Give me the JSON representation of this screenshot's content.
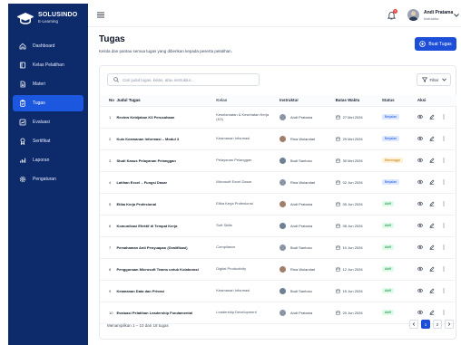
{
  "brand": {
    "name": "SOLUSINDO",
    "subtitle": "E-Learning"
  },
  "sidebar": {
    "items": [
      {
        "label": "Dashboard",
        "icon": "home-icon",
        "active": false
      },
      {
        "label": "Kelas Pelatihan",
        "icon": "book-icon",
        "active": false
      },
      {
        "label": "Materi",
        "icon": "document-icon",
        "active": false
      },
      {
        "label": "Tugas",
        "icon": "clipboard-icon",
        "active": true
      },
      {
        "label": "Evaluasi",
        "icon": "chart-line-icon",
        "active": false
      },
      {
        "label": "Sertifikat",
        "icon": "award-icon",
        "active": false
      },
      {
        "label": "Laporan",
        "icon": "bar-chart-icon",
        "active": false
      },
      {
        "label": "Pengaturan",
        "icon": "gear-icon",
        "active": false
      }
    ]
  },
  "topbar": {
    "notification_count": "3",
    "user_name": "Andi Pratama",
    "user_role": "Instruktur"
  },
  "page": {
    "title": "Tugas",
    "subtitle": "Kelola dan pantau semua tugas yang diberikan kepada peserta pelatihan.",
    "add_button": "Buat Tugas"
  },
  "search": {
    "placeholder": "Cari judul tugas, kelas, atau instruktur..."
  },
  "filter": {
    "label": "Filter"
  },
  "table": {
    "headers": [
      "No",
      "Judul Tugas",
      "Kelas",
      "Instruktur",
      "Batas Waktu",
      "Status",
      "Aksi"
    ],
    "rows": [
      {
        "no": "1",
        "judul": "Review Kebijakan K3 Perusahaan",
        "kelas": "Keselamatan & Kesehatan Kerja (K3)",
        "instruktur": "Andi Pratama",
        "batas": "27 Mei 2026",
        "status": "Berjalan"
      },
      {
        "no": "2",
        "judul": "Kuis Keamanan Informasi – Modul 3",
        "kelas": "Keamanan Informasi",
        "instruktur": "Rina Wulandari",
        "batas": "29 Mei 2026",
        "status": "Berjalan"
      },
      {
        "no": "3",
        "judul": "Studi Kasus Pelayanan Pelanggan",
        "kelas": "Pelayanan Pelanggan",
        "instruktur": "Budi Santoso",
        "batas": "30 Mei 2026",
        "status": "Menunggu"
      },
      {
        "no": "4",
        "judul": "Latihan Excel – Fungsi Dasar",
        "kelas": "Microsoft Excel Dasar",
        "instruktur": "Rina Wulandari",
        "batas": "02 Jun 2026",
        "status": "Berjalan"
      },
      {
        "no": "5",
        "judul": "Etika Kerja Profesional",
        "kelas": "Etika Kerja Profesional",
        "instruktur": "Andi Pratama",
        "batas": "05 Jun 2026",
        "status": "Aktif"
      },
      {
        "no": "6",
        "judul": "Komunikasi Efektif di Tempat Kerja",
        "kelas": "Soft Skills",
        "instruktur": "Andi Pratama",
        "batas": "08 Jun 2026",
        "status": "Aktif"
      },
      {
        "no": "7",
        "judul": "Pemahaman Anti Penyuapan (Gratifikasi)",
        "kelas": "Compliance",
        "instruktur": "Budi Santoso",
        "batas": "10 Jun 2026",
        "status": "Aktif"
      },
      {
        "no": "8",
        "judul": "Penggunaan Microsoft Teams untuk Kolaborasi",
        "kelas": "Digital Productivity",
        "instruktur": "Rina Wulandari",
        "batas": "12 Jun 2026",
        "status": "Aktif"
      },
      {
        "no": "9",
        "judul": "Keamanan Data dan Privasi",
        "kelas": "Keamanan Informasi",
        "instruktur": "Budi Santoso",
        "batas": "15 Jun 2026",
        "status": "Aktif"
      },
      {
        "no": "10",
        "judul": "Evaluasi Pelatihan Leadership Fundamental",
        "kelas": "Leadership Development",
        "instruktur": "Andi Pratama",
        "batas": "20 Jun 2026",
        "status": "Aktif"
      }
    ]
  },
  "footer": {
    "info": "Menampilkan 1 – 10 dari 18 tugas",
    "pages": [
      "1",
      "2"
    ],
    "current_page": "1"
  },
  "colors": {
    "sidebar_bg": "#0d2a6b",
    "accent": "#1d4ed8",
    "status_berjalan": "#1d4ed8",
    "status_menunggu": "#c2710c",
    "status_aktif": "#15803d"
  }
}
